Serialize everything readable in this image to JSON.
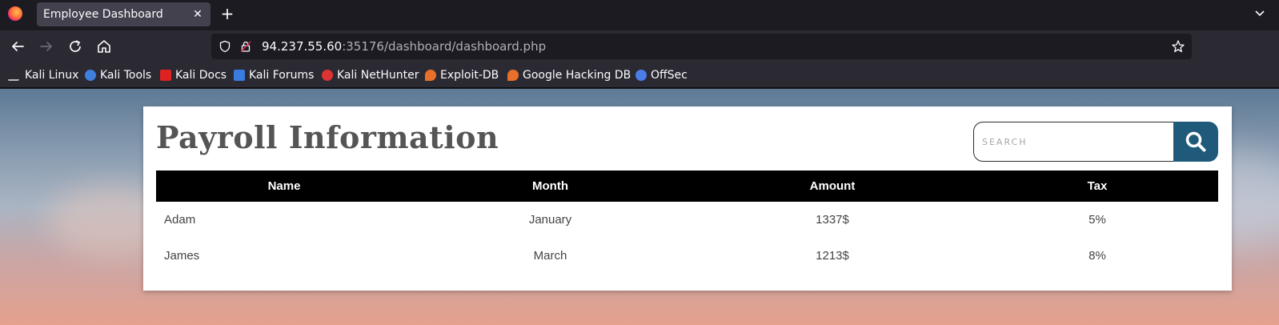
{
  "browser": {
    "tab_title": "Employee Dashboard",
    "url_host": "94.237.55.60",
    "url_rest": ":35176/dashboard/dashboard.php",
    "bookmarks": [
      {
        "label": "Kali Linux",
        "icon": "kali-linux-icon",
        "color": "#bbbbbb"
      },
      {
        "label": "Kali Tools",
        "icon": "kali-tools-icon",
        "color": "#3f7fe0"
      },
      {
        "label": "Kali Docs",
        "icon": "kali-docs-icon",
        "color": "#d22"
      },
      {
        "label": "Kali Forums",
        "icon": "kali-forums-icon",
        "color": "#3a7be0"
      },
      {
        "label": "Kali NetHunter",
        "icon": "kali-nethunter-icon",
        "color": "#d33"
      },
      {
        "label": "Exploit-DB",
        "icon": "exploit-db-icon",
        "color": "#e8702a"
      },
      {
        "label": "Google Hacking DB",
        "icon": "ghdb-icon",
        "color": "#e8702a"
      },
      {
        "label": "OffSec",
        "icon": "offsec-icon",
        "color": "#4a7de8"
      }
    ]
  },
  "page": {
    "title": "Payroll Information",
    "search_placeholder": "SEARCH",
    "accent_color": "#1f5a7a"
  },
  "table": {
    "headers": [
      "Name",
      "Month",
      "Amount",
      "Tax"
    ],
    "rows": [
      [
        "Adam",
        "January",
        "1337$",
        "5%"
      ],
      [
        "James",
        "March",
        "1213$",
        "8%"
      ]
    ]
  }
}
